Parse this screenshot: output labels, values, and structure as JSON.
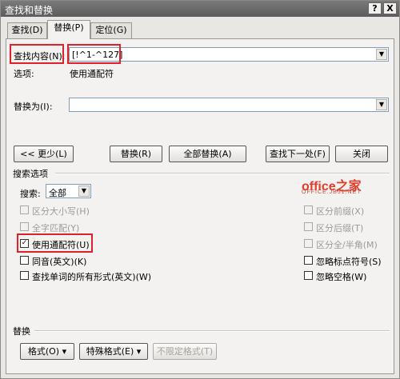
{
  "window": {
    "title": "查找和替换",
    "help_label": "?",
    "close_label": "X"
  },
  "tabs": [
    {
      "label": "查找(D)",
      "active": false
    },
    {
      "label": "替换(P)",
      "active": true
    },
    {
      "label": "定位(G)",
      "active": false
    }
  ],
  "find": {
    "label": "查找内容(N):",
    "value": "[!^1-^127]",
    "options_label": "选项:",
    "options_value": "使用通配符"
  },
  "replace": {
    "label": "替换为(I):",
    "value": ""
  },
  "buttons": {
    "less": "<< 更少(L)",
    "replace": "替换(R)",
    "replace_all": "全部替换(A)",
    "find_next": "查找下一处(F)",
    "close": "关闭"
  },
  "search_options": {
    "section_label": "搜索选项",
    "search_label": "搜索:",
    "search_value": "全部",
    "left_checks": [
      {
        "label": "区分大小写(H)",
        "checked": false,
        "enabled": false
      },
      {
        "label": "全字匹配(Y)",
        "checked": false,
        "enabled": false
      },
      {
        "label": "使用通配符(U)",
        "checked": true,
        "enabled": true
      },
      {
        "label": "同音(英文)(K)",
        "checked": false,
        "enabled": true
      },
      {
        "label": "查找单词的所有形式(英文)(W)",
        "checked": false,
        "enabled": true
      }
    ],
    "right_checks": [
      {
        "label": "区分前缀(X)",
        "checked": false,
        "enabled": false
      },
      {
        "label": "区分后缀(T)",
        "checked": false,
        "enabled": false
      },
      {
        "label": "区分全/半角(M)",
        "checked": false,
        "enabled": false
      },
      {
        "label": "忽略标点符号(S)",
        "checked": false,
        "enabled": true
      },
      {
        "label": "忽略空格(W)",
        "checked": false,
        "enabled": true
      }
    ]
  },
  "replace_section": {
    "label": "替换",
    "format": "格式(O) ▾",
    "special": "特殊格式(E) ▾",
    "no_format": "不限定格式(T)"
  },
  "watermark": {
    "line1": "office之家",
    "line2": "OFFICE.JB51.NET"
  },
  "colors": {
    "highlight_red": "#e0202a"
  }
}
